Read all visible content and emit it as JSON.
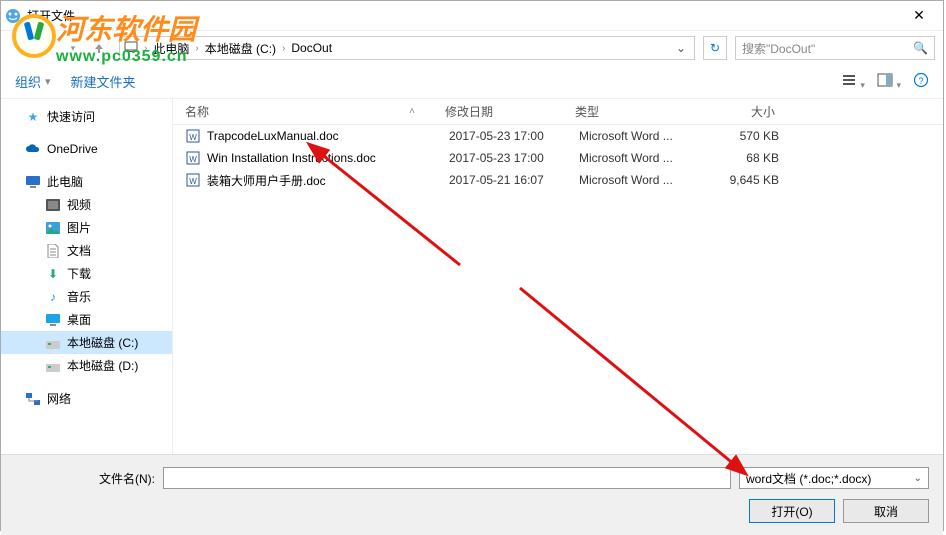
{
  "title": "打开文件",
  "breadcrumb": {
    "item1": "此电脑",
    "item2": "本地磁盘 (C:)",
    "item3": "DocOut"
  },
  "search": {
    "placeholder": "搜索\"DocOut\""
  },
  "toolbar": {
    "organize": "组织",
    "newfolder": "新建文件夹"
  },
  "columns": {
    "name": "名称",
    "date": "修改日期",
    "type": "类型",
    "size": "大小"
  },
  "sidebar": {
    "quick": "快速访问",
    "onedrive": "OneDrive",
    "thispc": "此电脑",
    "video": "视频",
    "pictures": "图片",
    "documents": "文档",
    "downloads": "下载",
    "music": "音乐",
    "desktop": "桌面",
    "diskc": "本地磁盘 (C:)",
    "diskd": "本地磁盘 (D:)",
    "network": "网络"
  },
  "files": {
    "f1": {
      "name": "TrapcodeLuxManual.doc",
      "date": "2017-05-23 17:00",
      "type": "Microsoft Word ...",
      "size": "570 KB"
    },
    "f2": {
      "name": "Win Installation Instructions.doc",
      "date": "2017-05-23 17:00",
      "type": "Microsoft Word ...",
      "size": "68 KB"
    },
    "f3": {
      "name": "装箱大师用户手册.doc",
      "date": "2017-05-21 16:07",
      "type": "Microsoft Word ...",
      "size": "9,645 KB"
    }
  },
  "footer": {
    "filename_label": "文件名(N):",
    "filter": "word文档 (*.doc;*.docx)",
    "open": "打开(O)",
    "cancel": "取消"
  },
  "watermark": {
    "text": "河东软件园",
    "url": "www.pc0359.cn"
  }
}
